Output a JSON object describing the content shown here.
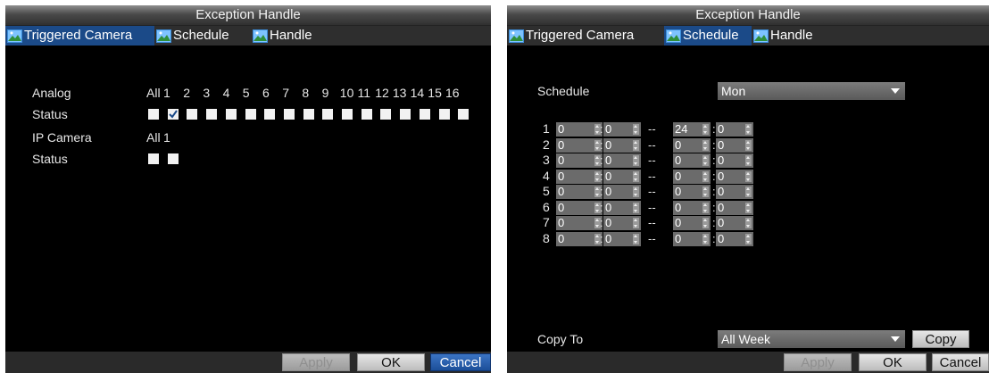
{
  "left": {
    "title": "Exception Handle",
    "tabs": [
      {
        "label": "Triggered Camera",
        "active": true
      },
      {
        "label": "Schedule",
        "active": false
      },
      {
        "label": "Handle",
        "active": false
      }
    ],
    "analog_label": "Analog",
    "analog_all": "All",
    "channels": [
      "1",
      "2",
      "3",
      "4",
      "5",
      "6",
      "7",
      "8",
      "9",
      "10",
      "11",
      "12",
      "13",
      "14",
      "15",
      "16"
    ],
    "status_label": "Status",
    "analog_status_checked_index": 1,
    "ip_camera_label": "IP Camera",
    "ip_channels": [
      "All",
      "1"
    ],
    "ip_status_label": "Status",
    "buttons": {
      "apply": "Apply",
      "ok": "OK",
      "cancel": "Cancel"
    }
  },
  "right": {
    "title": "Exception Handle",
    "tabs": [
      {
        "label": "Triggered Camera",
        "active": false
      },
      {
        "label": "Schedule",
        "active": true
      },
      {
        "label": "Handle",
        "active": false
      }
    ],
    "schedule_label": "Schedule",
    "schedule_value": "Mon",
    "periods": [
      {
        "row": "1",
        "start_h": "0",
        "start_m": "0",
        "end_h": "24",
        "end_m": "0"
      },
      {
        "row": "2",
        "start_h": "0",
        "start_m": "0",
        "end_h": "0",
        "end_m": "0"
      },
      {
        "row": "3",
        "start_h": "0",
        "start_m": "0",
        "end_h": "0",
        "end_m": "0"
      },
      {
        "row": "4",
        "start_h": "0",
        "start_m": "0",
        "end_h": "0",
        "end_m": "0"
      },
      {
        "row": "5",
        "start_h": "0",
        "start_m": "0",
        "end_h": "0",
        "end_m": "0"
      },
      {
        "row": "6",
        "start_h": "0",
        "start_m": "0",
        "end_h": "0",
        "end_m": "0"
      },
      {
        "row": "7",
        "start_h": "0",
        "start_m": "0",
        "end_h": "0",
        "end_m": "0"
      },
      {
        "row": "8",
        "start_h": "0",
        "start_m": "0",
        "end_h": "0",
        "end_m": "0"
      }
    ],
    "colon": ":",
    "dash": "--",
    "copy_to_label": "Copy To",
    "copy_to_value": "All Week",
    "copy_button": "Copy",
    "buttons": {
      "apply": "Apply",
      "ok": "OK",
      "cancel": "Cancel"
    }
  },
  "colors": {
    "tab_active": "#1b4a88",
    "primary_button": "#2a5eae"
  }
}
